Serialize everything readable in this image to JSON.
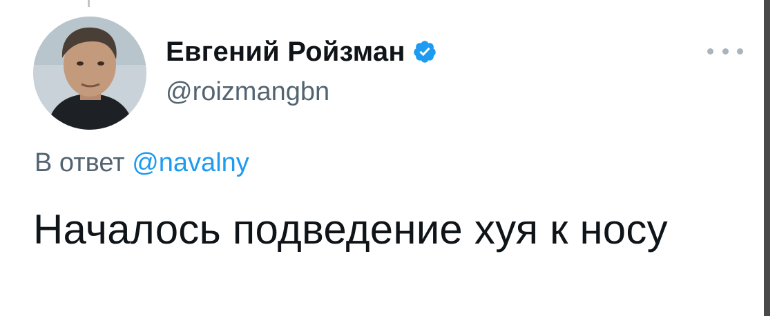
{
  "tweet": {
    "author": {
      "display_name": "Евгений Ройзман",
      "handle": "@roizmangbn",
      "verified": true,
      "avatar_icon": "profile-photo"
    },
    "more_icon": "more-options-icon",
    "reply_to": {
      "prefix": "В ответ",
      "handle": "@navalny"
    },
    "text": "Началось подведение хуя к носу"
  },
  "colors": {
    "verified_badge": "#1d9bf0",
    "link": "#1d9bf0",
    "secondary_text": "#536471",
    "primary_text": "#0f1419"
  }
}
